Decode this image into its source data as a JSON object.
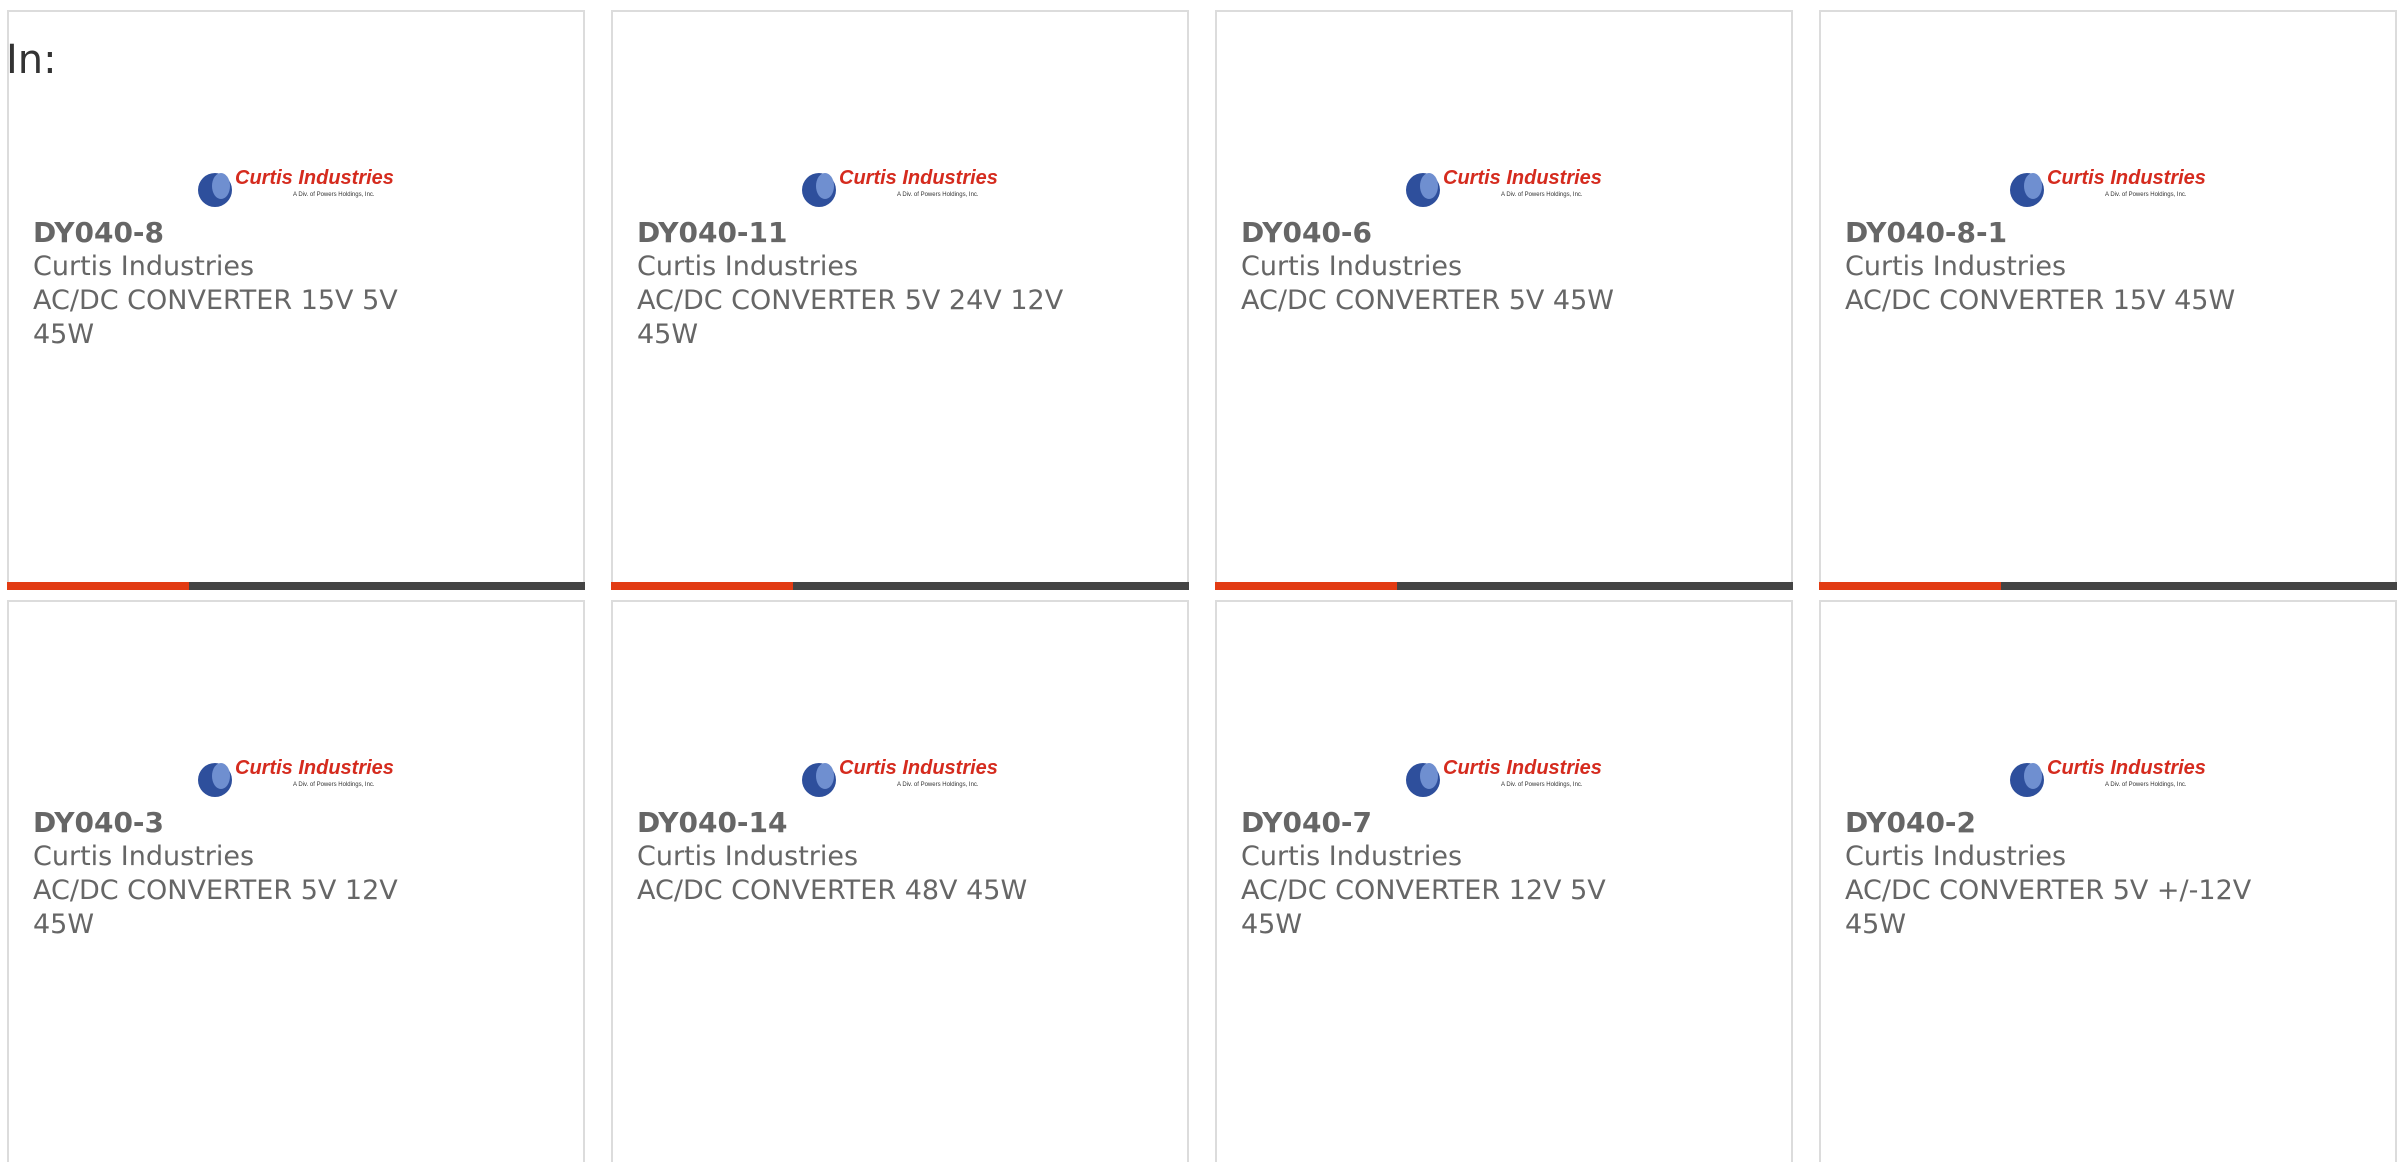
{
  "header": {
    "in_label": "In:"
  },
  "logo": {
    "brand_text": "Curtis Industries",
    "tagline": "A Div. of Powers Holdings, Inc.",
    "brand_color": "#d52b1e",
    "globe_color": "#2e4f9c"
  },
  "accent_color": "#e23b13",
  "bar_color": "#444444",
  "products": [
    {
      "part": "DY040-8",
      "maker": "Curtis Industries",
      "desc": "AC/DC CONVERTER 15V 5V 45W"
    },
    {
      "part": "DY040-11",
      "maker": "Curtis Industries",
      "desc": "AC/DC CONVERTER 5V 24V 12V 45W"
    },
    {
      "part": "DY040-6",
      "maker": "Curtis Industries",
      "desc": "AC/DC CONVERTER 5V 45W"
    },
    {
      "part": "DY040-8-1",
      "maker": "Curtis Industries",
      "desc": "AC/DC CONVERTER 15V 45W"
    },
    {
      "part": "DY040-3",
      "maker": "Curtis Industries",
      "desc": "AC/DC CONVERTER 5V 12V 45W"
    },
    {
      "part": "DY040-14",
      "maker": "Curtis Industries",
      "desc": "AC/DC CONVERTER 48V 45W"
    },
    {
      "part": "DY040-7",
      "maker": "Curtis Industries",
      "desc": "AC/DC CONVERTER 12V 5V 45W"
    },
    {
      "part": "DY040-2",
      "maker": "Curtis Industries",
      "desc": "AC/DC CONVERTER 5V +/-12V 45W"
    }
  ]
}
